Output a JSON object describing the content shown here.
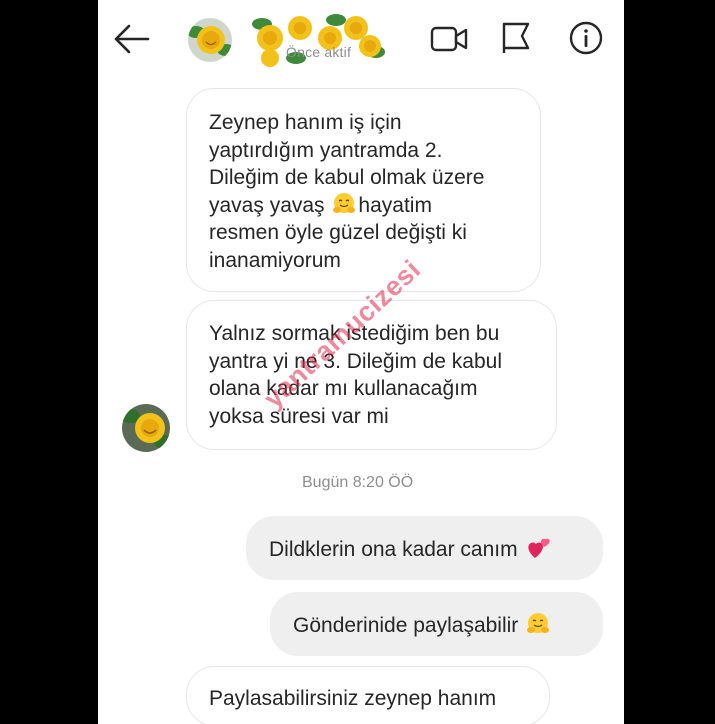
{
  "header": {
    "status_text": "Önce aktif"
  },
  "messages": [
    {
      "sender": "other",
      "lines": [
        "Zeynep hanım iş için",
        "yaptırdığım yantramda 2.",
        "Dileğim de kabul olmak üzere",
        "yavaş yavaş",
        "hayatim",
        "resmen öyle güzel değişti ki",
        "inanamiyorum"
      ],
      "emoji": "hugging-face"
    },
    {
      "sender": "other",
      "lines": [
        "Yalnız sormak istediğim ben bu",
        "yantra yi ne 3. Dileğim de kabul",
        "olana kadar mı kullanacağım",
        "yoksa süresi var mi"
      ]
    },
    {
      "sender": "me",
      "text": "Dildklerin ona kadar canım",
      "emoji": "two-hearts"
    },
    {
      "sender": "me",
      "text": "Gönderinide paylaşabilir",
      "emoji": "hugging-face"
    },
    {
      "sender": "other",
      "text": "Paylasabilirsiniz zeynep hanım"
    }
  ],
  "timestamp": "Bugün 8:20 ÖÖ",
  "watermark": "yantramucizesi",
  "colors": {
    "incoming_border": "#e6e6e6",
    "outgoing_bg": "#efefef",
    "text": "#262626",
    "muted": "#8e8e8e",
    "watermark": "#e22848"
  }
}
